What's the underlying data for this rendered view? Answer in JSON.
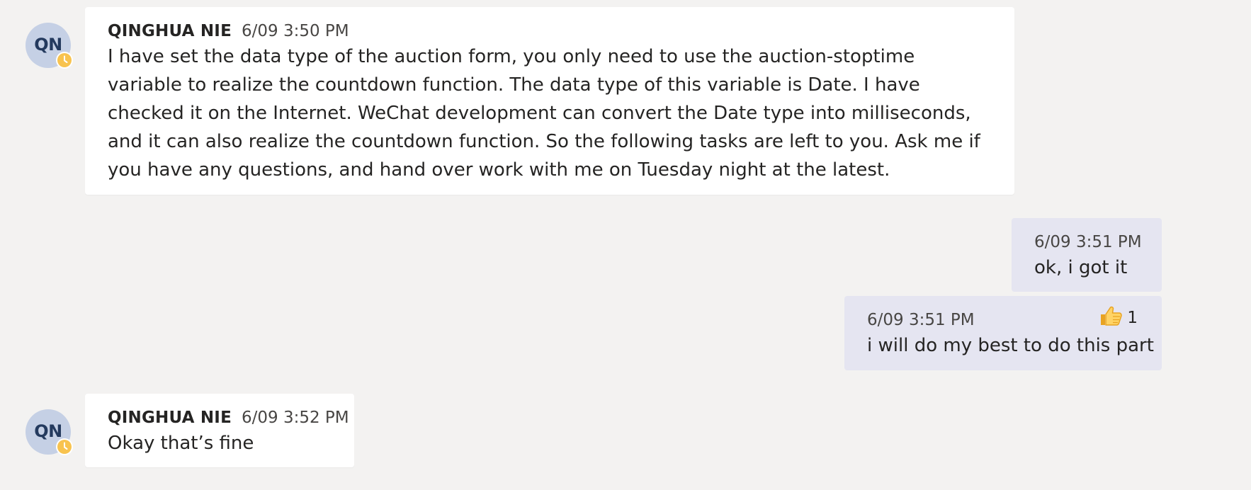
{
  "messages": [
    {
      "sender": "QINGHUA NIE",
      "initials": "QN",
      "timestamp": "6/09 3:50 PM",
      "text": "I have set the data type of the auction form, you only need to use the auction-stoptime variable to realize the countdown function.  The data type of this variable is Date.  I have checked it on the Internet. WeChat development can convert the Date type into milliseconds, and it can also realize the countdown function.  So the following tasks are left to you.  Ask me if you have any questions, and hand over work with me on Tuesday night at the latest."
    },
    {
      "timestamp": "6/09 3:51 PM",
      "text": "ok, i got it"
    },
    {
      "timestamp": "6/09 3:51 PM",
      "text": "i will do my best to do this part",
      "reaction": {
        "icon": "thumbs-up-icon",
        "count": "1"
      }
    },
    {
      "sender": "QINGHUA NIE",
      "initials": "QN",
      "timestamp": "6/09 3:52 PM",
      "text": "Okay that’s fine"
    }
  ],
  "colors": {
    "background": "#f3f2f1",
    "avatar_bg": "#c5d0e5",
    "avatar_text": "#243a5e",
    "presence_away": "#f8c34f",
    "mine_bubble": "#e5e5f1",
    "other_bubble": "#ffffff"
  }
}
